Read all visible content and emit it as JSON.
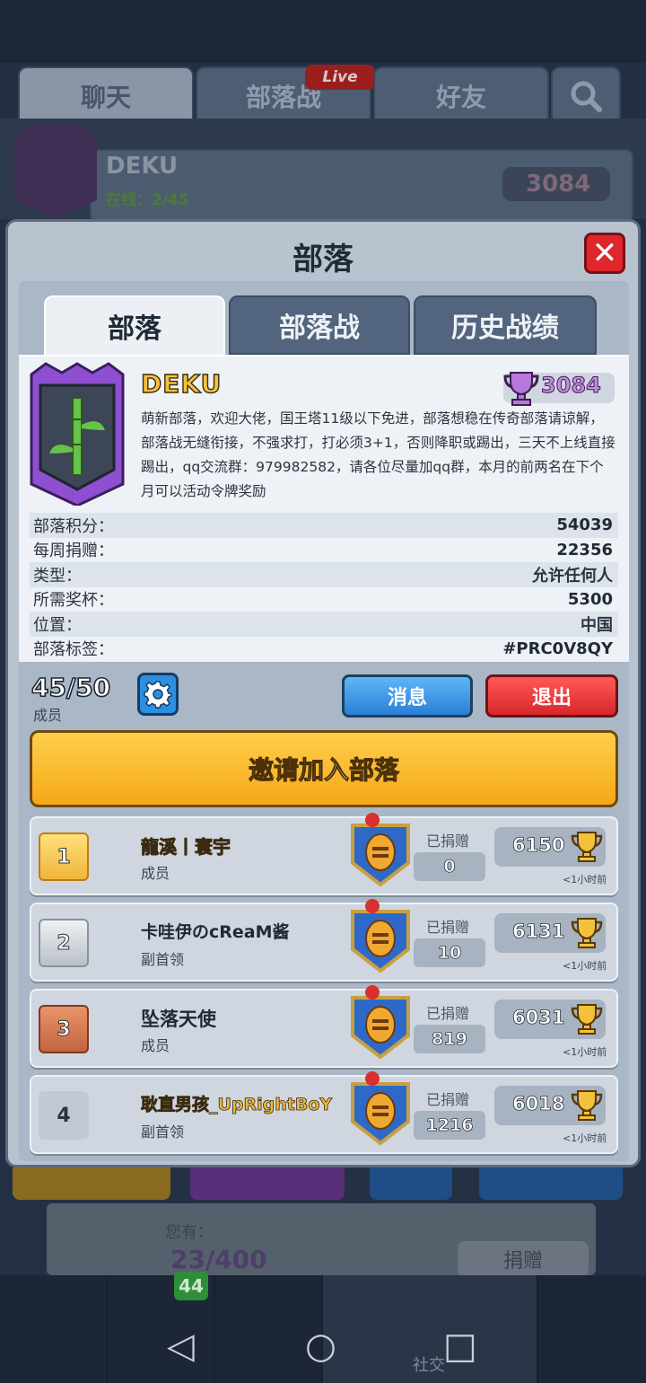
{
  "background": {
    "tabs": [
      "聊天",
      "部落战",
      "好友"
    ],
    "live_badge": "Live",
    "clan_name": "DEKU",
    "online": "在线：2/45",
    "trophies": "3084",
    "you_have_label": "您有：",
    "donate_count": "23/400",
    "donate_button": "捐赠",
    "nav_badge": "44",
    "nav_social": "社交"
  },
  "modal": {
    "title": "部落",
    "tabs": [
      "部落",
      "部落战",
      "历史战绩"
    ],
    "clan": {
      "name": "DEKU",
      "trophies": "3084",
      "description": "萌新部落，欢迎大佬，国王塔11级以下免进，部落想稳在传奇部落请谅解，部落战无缝衔接，不强求打，打必须3+1，否则降职或踢出，三天不上线直接踢出，qq交流群：979982582，请各位尽量加qq群，本月的前两名在下个月可以活动令牌奖励"
    },
    "stats": [
      {
        "label": "部落积分：",
        "value": "54039"
      },
      {
        "label": "每周捐赠：",
        "value": "22356"
      },
      {
        "label": "类型：",
        "value": "允许任何人"
      },
      {
        "label": "所需奖杯：",
        "value": "5300"
      },
      {
        "label": "位置：",
        "value": "中国"
      },
      {
        "label": "部落标签：",
        "value": "#PRC0V8QY"
      }
    ],
    "members_count": "45/50",
    "members_label": "成员",
    "message_button": "消息",
    "leave_button": "退出",
    "invite_button": "邀请加入部落",
    "donated_label": "已捐赠",
    "members": [
      {
        "rank": "1",
        "name": "龍溪丨寰宇",
        "role": "成员",
        "donated": "0",
        "trophies": "6150",
        "ago": "<1小时前"
      },
      {
        "rank": "2",
        "name": "卡哇伊のcReaM酱",
        "role": "副首领",
        "donated": "10",
        "trophies": "6131",
        "ago": "<1小时前"
      },
      {
        "rank": "3",
        "name": "坠落天使",
        "role": "成员",
        "donated": "819",
        "trophies": "6031",
        "ago": "<1小时前"
      },
      {
        "rank": "4",
        "name": "耿直男孩_UpRightBoY",
        "role": "副首领",
        "donated": "1216",
        "trophies": "6018",
        "ago": "<1小时前"
      }
    ]
  },
  "colors": {
    "accent_gold": "#f2c23a",
    "button_blue": "#2b7fd6",
    "button_red": "#d8262a",
    "invite_yellow": "#f5a818"
  }
}
